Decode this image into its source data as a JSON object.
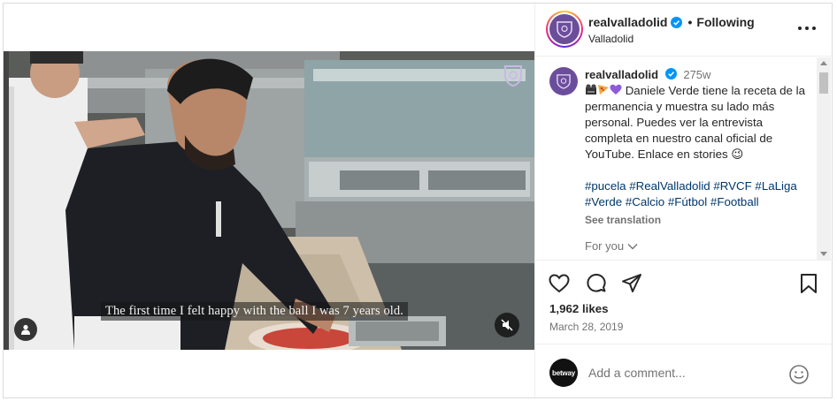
{
  "post": {
    "username": "realvalladolid",
    "follow_status": "Following",
    "location": "Valladolid",
    "subtitle": "The first time I felt happy with the ball I was 7 years old."
  },
  "comment": {
    "username": "realvalladolid",
    "time": "275w",
    "caption": "Daniele Verde tiene la receta de la permanencia y muestra su lado más personal. Puedes ver la entrevista completa en nuestro canal oficial de YouTube. Enlace en stories 😉",
    "hashtags": "#pucela #RealValladolid #RVCF #LaLiga #Verde #Calcio #Fútbol #Football",
    "see_translation": "See translation",
    "for_you": "For you"
  },
  "stats": {
    "likes": "1,962 likes",
    "date": "March 28, 2019"
  },
  "add_comment": {
    "avatar_text": "betway",
    "placeholder": "Add a comment..."
  },
  "icons": [
    "more-icon",
    "heart-icon",
    "comment-icon",
    "share-icon",
    "bookmark-icon",
    "emoji-icon",
    "tag-user-icon",
    "mute-icon",
    "verified-icon",
    "chevron-down-icon"
  ],
  "colors": {
    "verified": "#0095f6",
    "hashtag": "#00376b",
    "muted_text": "#737373",
    "crest": "#6b4e9b"
  }
}
